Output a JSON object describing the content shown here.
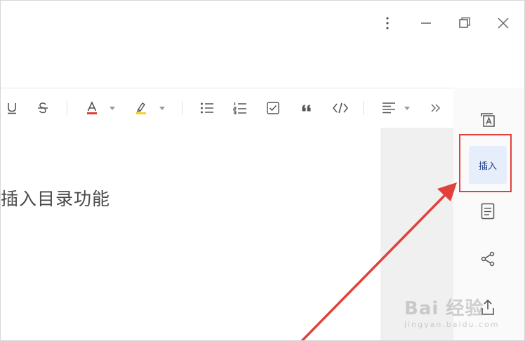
{
  "window_controls": {
    "more": "more-vertical-icon",
    "minimize": "minimize-icon",
    "restore": "restore-icon",
    "close": "close-icon"
  },
  "toolbar": {
    "items": [
      "underline-icon",
      "strikethrough-icon",
      "font-color-icon",
      "dropdown-caret-icon",
      "highlight-icon",
      "dropdown-caret-icon",
      "bulleted-list-icon",
      "numbered-list-icon",
      "checkbox-list-icon",
      "quote-icon",
      "code-icon",
      "align-icon",
      "dropdown-caret-icon",
      "expand-more-icon"
    ],
    "font_color": "#e0413b",
    "highlight_color": "#f5d327"
  },
  "document": {
    "text": "插入目录功能"
  },
  "sidebar": {
    "insert_label": "插入",
    "icons": [
      "text-frame-icon",
      "outline-icon",
      "share-icon",
      "export-icon"
    ]
  },
  "annotation": {
    "color": "#e0413b"
  },
  "watermark": {
    "text": "Bai 经验",
    "url": "jingyan.baidu.com"
  }
}
